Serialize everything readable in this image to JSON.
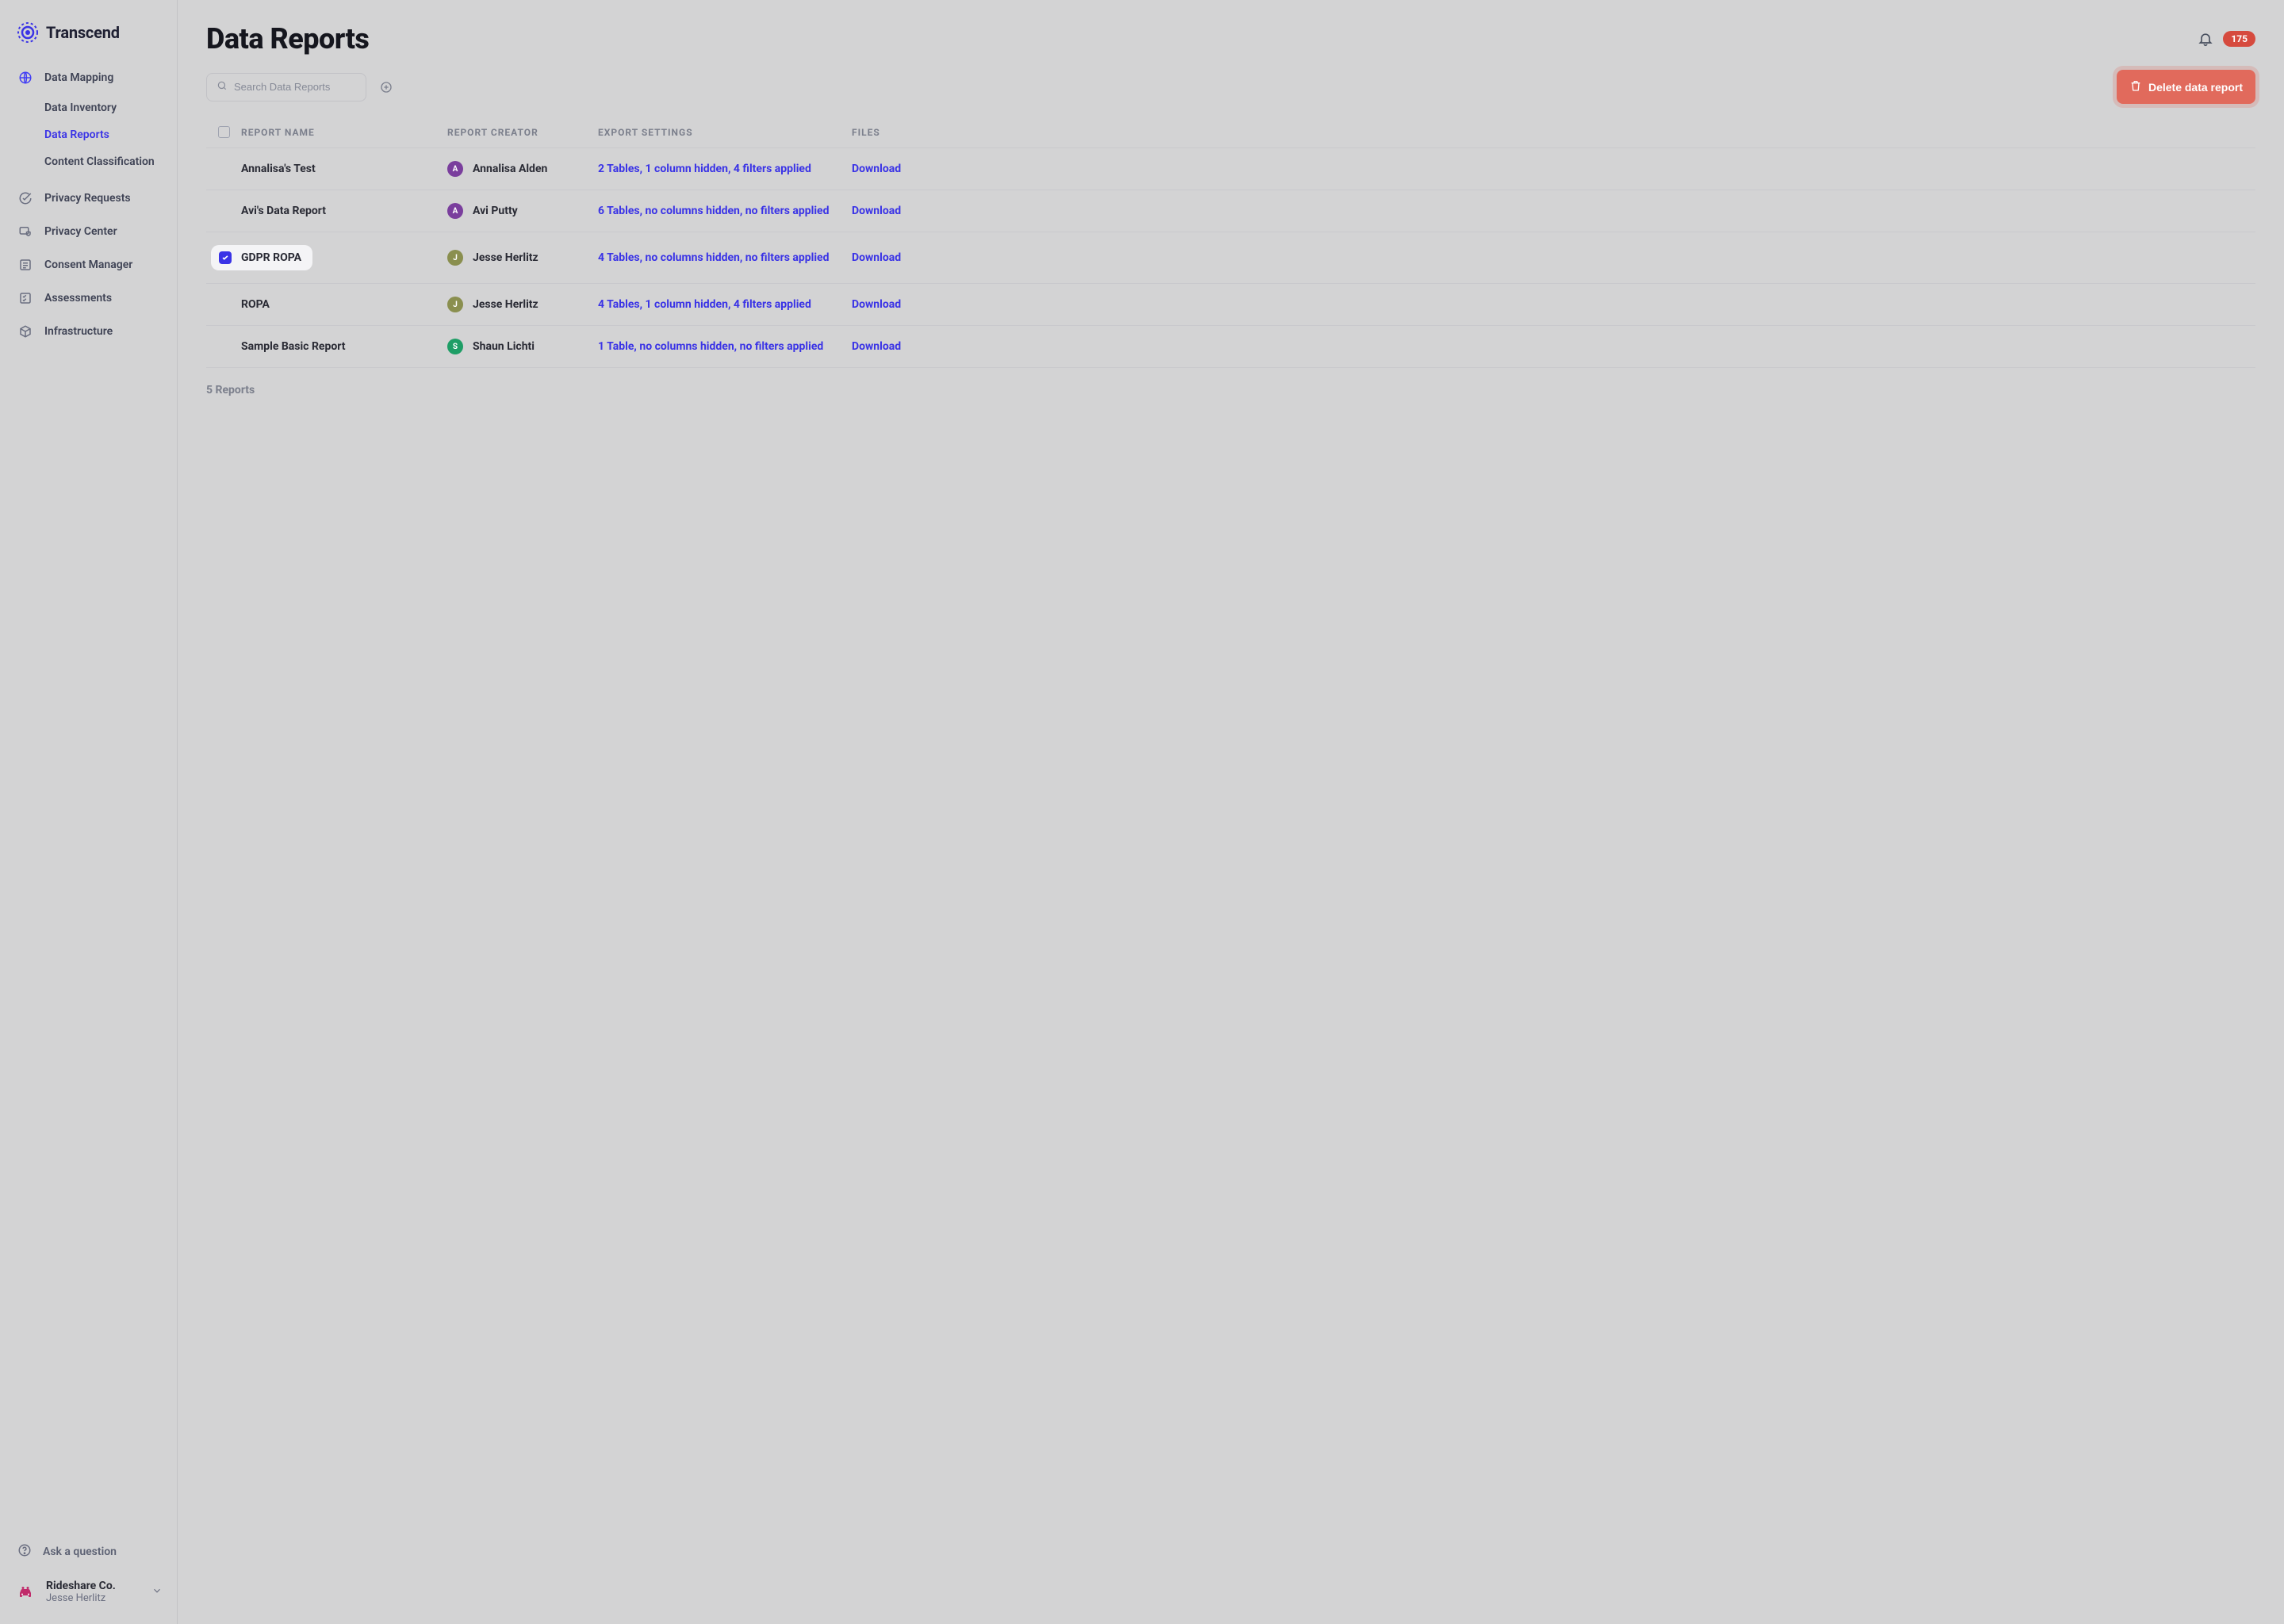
{
  "brand": {
    "name": "Transcend"
  },
  "sidebar": {
    "data_mapping": "Data Mapping",
    "data_inventory": "Data Inventory",
    "data_reports": "Data Reports",
    "content_classification": "Content Classification",
    "privacy_requests": "Privacy Requests",
    "privacy_center": "Privacy Center",
    "consent_manager": "Consent Manager",
    "assessments": "Assessments",
    "infrastructure": "Infrastructure",
    "ask_question": "Ask a question",
    "org_name": "Rideshare Co.",
    "org_user": "Jesse Herlitz"
  },
  "header": {
    "title": "Data Reports",
    "badge": "175"
  },
  "toolbar": {
    "search_placeholder": "Search Data Reports",
    "delete_label": "Delete data report"
  },
  "columns": {
    "name": "REPORT NAME",
    "creator": "REPORT CREATOR",
    "export": "EXPORT SETTINGS",
    "files": "FILES"
  },
  "avatars": {
    "purple": "#7a3e9d",
    "olive": "#8a8f4f",
    "green": "#1e9e66"
  },
  "colors": {
    "accent": "#3a33e6",
    "danger": "#e16a5c",
    "badge": "#d64a3e"
  },
  "rows": [
    {
      "name": "Annalisa's Test",
      "creator": "Annalisa Alden",
      "initial": "A",
      "avatar_color": "#7a3e9d",
      "settings": "2 Tables, 1 column hidden, 4 filters applied",
      "download": "Download",
      "selected": false
    },
    {
      "name": "Avi's Data Report",
      "creator": "Avi Putty",
      "initial": "A",
      "avatar_color": "#7a3e9d",
      "settings": "6 Tables, no columns hidden, no filters applied",
      "download": "Download",
      "selected": false
    },
    {
      "name": "GDPR ROPA",
      "creator": "Jesse Herlitz",
      "initial": "J",
      "avatar_color": "#8a8f4f",
      "settings": "4 Tables, no columns hidden, no filters applied",
      "download": "Download",
      "selected": true
    },
    {
      "name": "ROPA",
      "creator": "Jesse Herlitz",
      "initial": "J",
      "avatar_color": "#8a8f4f",
      "settings": "4 Tables, 1 column hidden, 4 filters applied",
      "download": "Download",
      "selected": false
    },
    {
      "name": "Sample Basic Report",
      "creator": "Shaun Lichti",
      "initial": "S",
      "avatar_color": "#1e9e66",
      "settings": "1 Table, no columns hidden, no filters applied",
      "download": "Download",
      "selected": false
    }
  ],
  "footer": {
    "count": "5 Reports"
  }
}
